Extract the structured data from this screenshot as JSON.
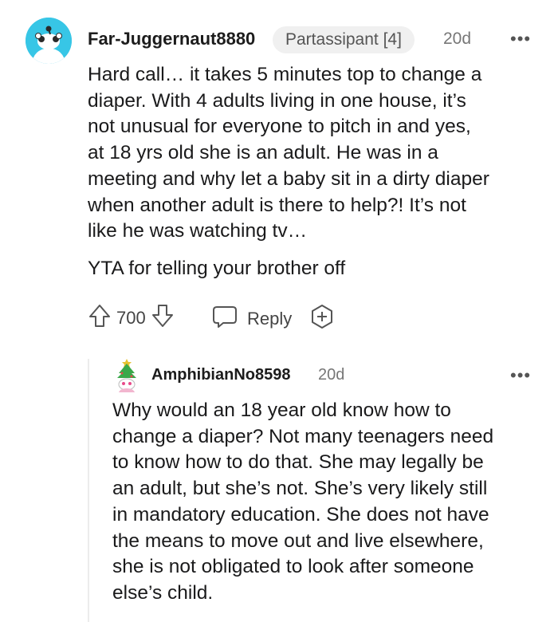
{
  "comment": {
    "username": "Far-Juggernaut8880",
    "flair": "Partassipant [4]",
    "time": "20d",
    "paragraph1": "Hard call… it takes 5 minutes top to change a\ndiaper. With 4 adults living in one house, it’s\nnot unusual for everyone to pitch in and yes,\nat 18 yrs old she is an adult. He was in a\nmeeting and why let a baby sit in a dirty diaper\nwhen another adult is there to help?! It’s not\nlike he was watching tv…",
    "paragraph2": "YTA for telling your brother off",
    "votes": "700",
    "reply_label": "Reply",
    "avatar_color": "#37c6e6"
  },
  "reply": {
    "username": "AmphibianNo8598",
    "time": "20d",
    "body": "Why would an 18 year old know how to\nchange a diaper? Not many teenagers need\nto know how to do that. She may legally be\nan adult, but she’s not. She’s very likely still\nin mandatory education. She does not have\nthe means to move out and live elsewhere,\nshe is not obligated to look after someone\nelse’s child."
  },
  "icons": {
    "upvote": "arrow-up-outline",
    "downvote": "arrow-down-outline",
    "reply": "chat-bubble-outline",
    "award": "plus-award-outline",
    "more": "three-dots-horizontal"
  }
}
